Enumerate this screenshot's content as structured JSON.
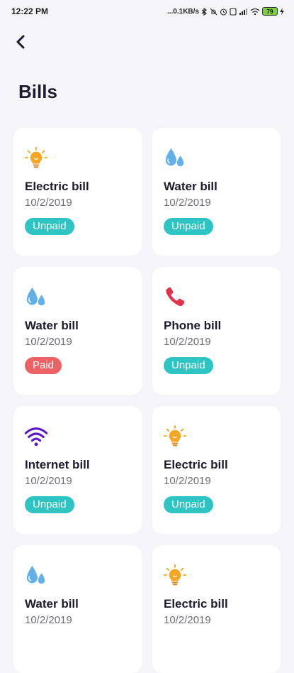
{
  "status_bar": {
    "time": "12:22 PM",
    "network_speed": "...0.1KB/s",
    "battery": "79"
  },
  "header": {
    "title": "Bills"
  },
  "colors": {
    "unpaid": "#2ec4c4",
    "paid": "#ec6265",
    "background": "#f4f4f9"
  },
  "bills": [
    {
      "icon": "bulb-icon",
      "title": "Electric bill",
      "date": "10/2/2019",
      "status": "Unpaid"
    },
    {
      "icon": "water-drop-icon",
      "title": "Water bill",
      "date": "10/2/2019",
      "status": "Unpaid"
    },
    {
      "icon": "water-drop-icon",
      "title": "Water bill",
      "date": "10/2/2019",
      "status": "Paid"
    },
    {
      "icon": "phone-icon",
      "title": "Phone bill",
      "date": "10/2/2019",
      "status": "Unpaid"
    },
    {
      "icon": "wifi-icon",
      "title": "Internet bill",
      "date": "10/2/2019",
      "status": "Unpaid"
    },
    {
      "icon": "bulb-icon",
      "title": "Electric bill",
      "date": "10/2/2019",
      "status": "Unpaid"
    },
    {
      "icon": "water-drop-icon",
      "title": "Water bill",
      "date": "10/2/2019",
      "status": ""
    },
    {
      "icon": "bulb-icon",
      "title": "Electric bill",
      "date": "10/2/2019",
      "status": ""
    }
  ]
}
